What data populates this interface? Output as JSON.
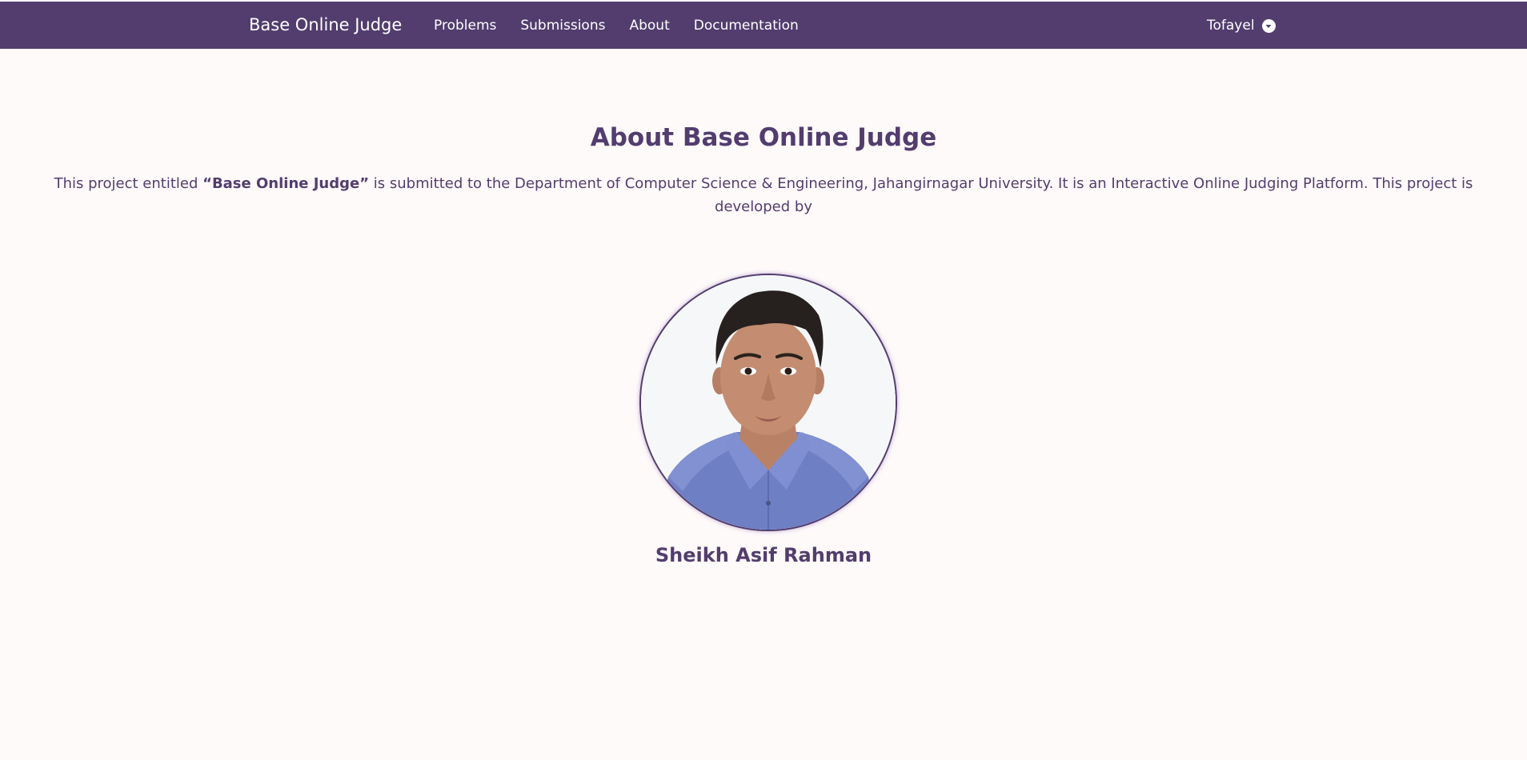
{
  "navbar": {
    "brand": "Base Online Judge",
    "links": [
      "Problems",
      "Submissions",
      "About",
      "Documentation"
    ],
    "user": "Tofayel",
    "colors": {
      "background": "#523d6e",
      "text": "#ffffff"
    }
  },
  "about": {
    "title": "About Base Online Judge",
    "intro_before": "This project entitled ",
    "project_name": "“Base Online Judge”",
    "intro_after": " is submitted to the Department of Computer Science & Engineering, Jahangirnagar University. It is an Interactive Online Judging Platform. This project is developed by"
  },
  "developer": {
    "name": "Sheikh Asif Rahman",
    "photo": "developer-photo"
  },
  "colors": {
    "accent": "#523d6e",
    "page_background": "#fffafa"
  }
}
